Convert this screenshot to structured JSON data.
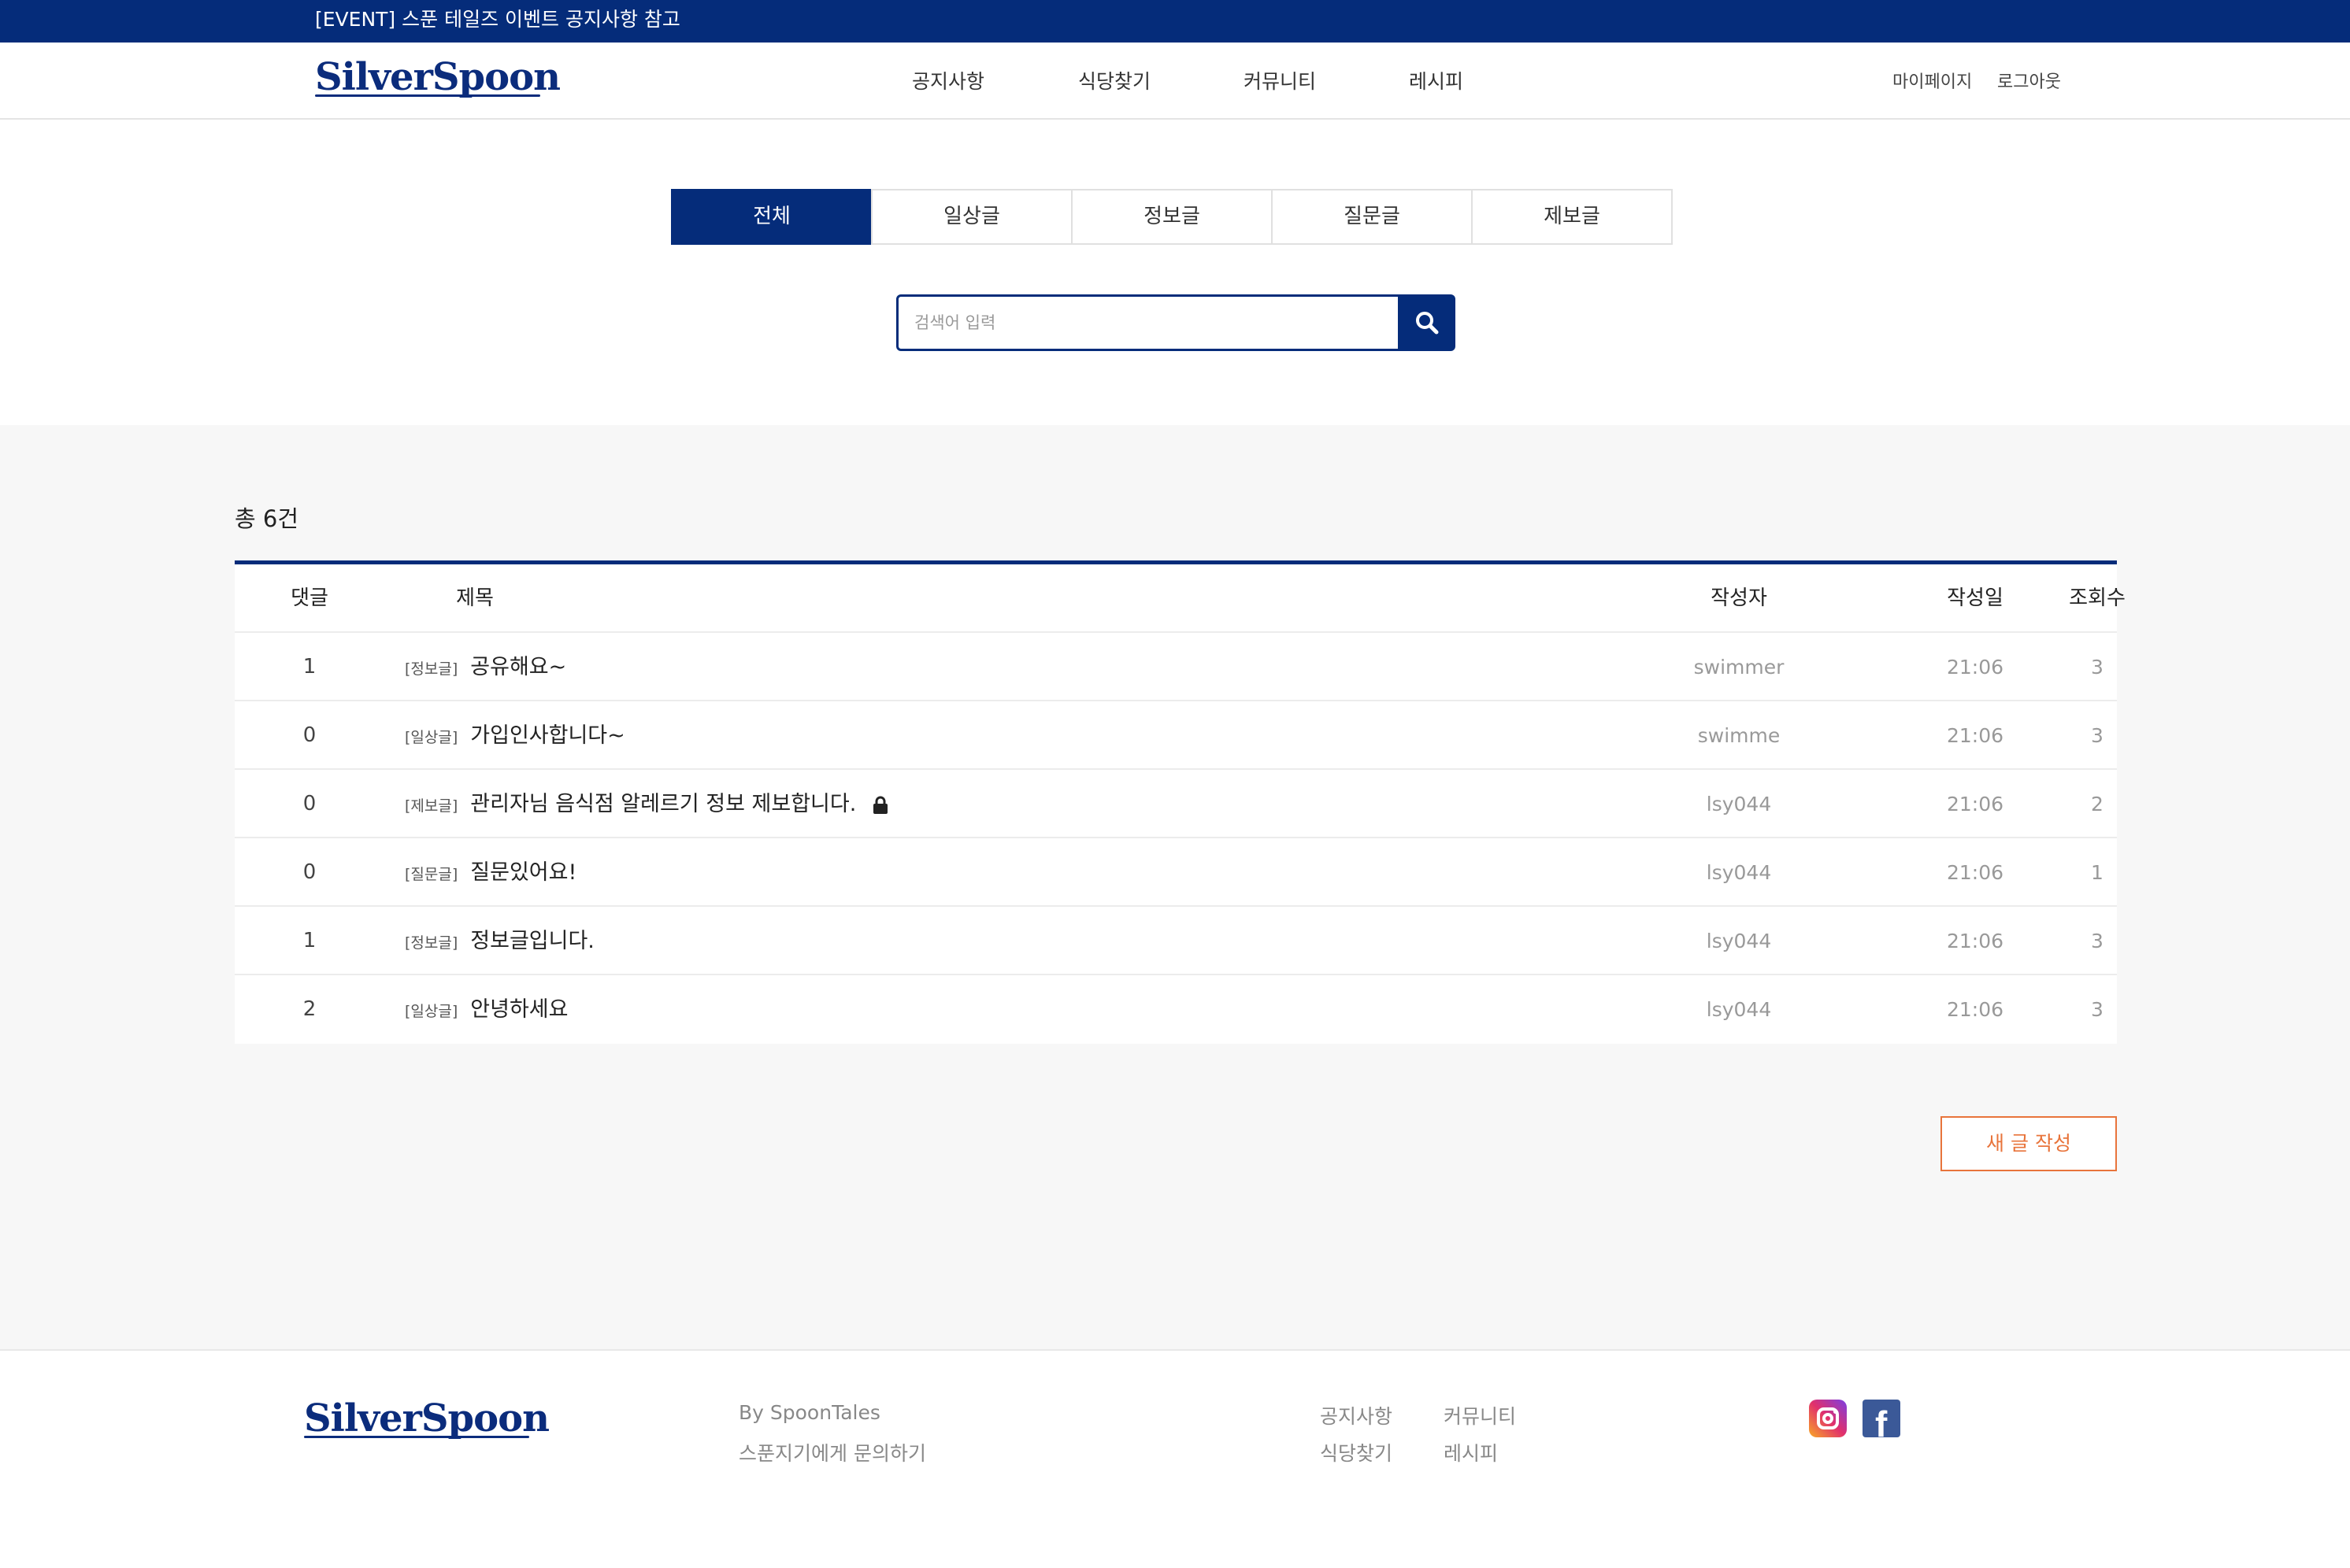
{
  "event_bar": {
    "text": "[EVENT] 스푼 테일즈 이벤트 공지사항 참고"
  },
  "header": {
    "logo": "SilverSpoon",
    "nav": [
      "공지사항",
      "식당찾기",
      "커뮤니티",
      "레시피"
    ],
    "util": [
      "마이페이지",
      "로그아웃"
    ]
  },
  "tabs": [
    {
      "label": "전체",
      "active": true
    },
    {
      "label": "일상글",
      "active": false
    },
    {
      "label": "정보글",
      "active": false
    },
    {
      "label": "질문글",
      "active": false
    },
    {
      "label": "제보글",
      "active": false
    }
  ],
  "search": {
    "placeholder": "검색어 입력",
    "value": "",
    "icon": "search-icon"
  },
  "board": {
    "total": "총 6건",
    "headers": {
      "comments": "댓글",
      "title": "제목",
      "author": "작성자",
      "date": "작성일",
      "views": "조회수"
    },
    "rows": [
      {
        "comments": "1",
        "category": "[정보글]",
        "title": "공유해요~",
        "locked": false,
        "author": "swimmer",
        "date": "21:06",
        "views": "3"
      },
      {
        "comments": "0",
        "category": "[일상글]",
        "title": "가입인사합니다~",
        "locked": false,
        "author": "swimme",
        "date": "21:06",
        "views": "3"
      },
      {
        "comments": "0",
        "category": "[제보글]",
        "title": "관리자님 음식점 알레르기 정보 제보합니다.",
        "locked": true,
        "author": "lsy044",
        "date": "21:06",
        "views": "2"
      },
      {
        "comments": "0",
        "category": "[질문글]",
        "title": "질문있어요!",
        "locked": false,
        "author": "lsy044",
        "date": "21:06",
        "views": "1"
      },
      {
        "comments": "1",
        "category": "[정보글]",
        "title": "정보글입니다.",
        "locked": false,
        "author": "lsy044",
        "date": "21:06",
        "views": "3"
      },
      {
        "comments": "2",
        "category": "[일상글]",
        "title": "안녕하세요",
        "locked": false,
        "author": "lsy044",
        "date": "21:06",
        "views": "3"
      }
    ],
    "write_button": "새 글 작성"
  },
  "footer": {
    "logo": "SilverSpoon",
    "by": "By SpoonTales",
    "contact": "스푼지기에게 문의하기",
    "links": [
      "공지사항",
      "커뮤니티",
      "식당찾기",
      "레시피"
    ],
    "social": [
      "instagram-icon",
      "facebook-icon"
    ]
  },
  "colors": {
    "primary": "#052c7a",
    "accent": "#e8743b",
    "bg_content": "#f7f7f7"
  }
}
